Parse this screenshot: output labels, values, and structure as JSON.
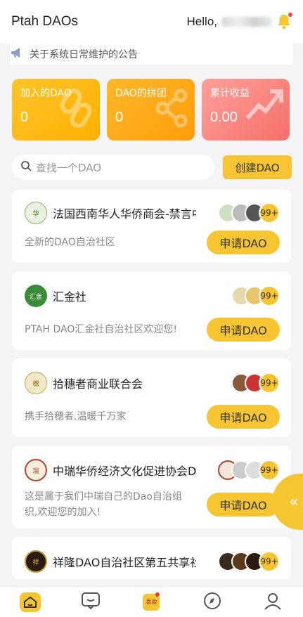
{
  "header": {
    "title": "Ptah DAOs",
    "hello": "Hello,"
  },
  "notice": {
    "text": "关于系统日常维护的公告"
  },
  "stats": [
    {
      "label": "加入的DAO",
      "value": "0"
    },
    {
      "label": "DAO的拼团",
      "value": "0"
    },
    {
      "label": "累计收益",
      "value": "0.00"
    }
  ],
  "search": {
    "placeholder": "查找一个DAO",
    "create_label": "创建DAO"
  },
  "daos": [
    {
      "name": "法国西南华人华侨商会-禁言中",
      "desc": "全新的DAO自治社区",
      "count": "99+",
      "apply": "申请DAO"
    },
    {
      "name": "汇金社",
      "desc": "PTAH DAO汇金社自治社区欢迎您!",
      "count": "99+",
      "apply": "申请DAO"
    },
    {
      "name": "拾穗者商业联合会",
      "desc": "携手拾穗者,温暖千万家",
      "count": "99+",
      "apply": "申请DAO"
    },
    {
      "name": "中瑞华侨经济文化促进协会Dao",
      "desc": "这是属于我们中瑞自己的Dao自治组织,欢迎您的加入!",
      "count": "99+",
      "apply": "申请DAO"
    },
    {
      "name": "祥隆DAO自治社区第五共享社",
      "desc": "",
      "count": "99+",
      "apply": ""
    }
  ],
  "side_tab": {
    "glyph": "«"
  },
  "tabbar": {
    "center_label": "喜盈"
  }
}
